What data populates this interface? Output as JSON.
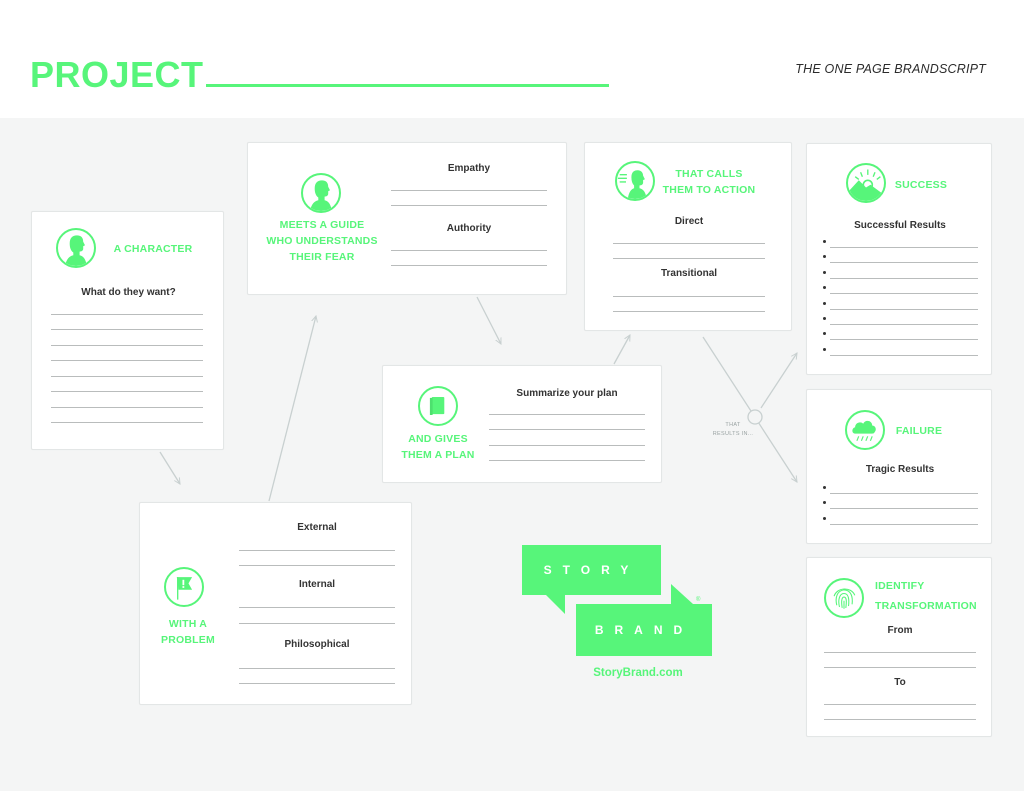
{
  "header": {
    "project_label": "PROJECT",
    "document_title": "THE ONE PAGE BRANDSCRIPT"
  },
  "brand_color": "#57f57a",
  "cards": {
    "character": {
      "icon": "person-silhouette-icon",
      "title": "A CHARACTER",
      "prompt": "What do they want?",
      "lines": 8
    },
    "guide": {
      "icon": "guide-silhouette-icon",
      "title_lines": [
        "MEETS A GUIDE",
        "WHO UNDERSTANDS",
        "THEIR FEAR"
      ],
      "fields": [
        "Empathy",
        "Authority"
      ]
    },
    "problem": {
      "icon": "flag-exclamation-icon",
      "title_lines": [
        "WITH A",
        "PROBLEM"
      ],
      "fields": [
        "External",
        "Internal",
        "Philosophical"
      ]
    },
    "plan": {
      "icon": "book-icon",
      "title_lines": [
        "AND GIVES",
        "THEM A PLAN"
      ],
      "prompt": "Summarize your plan"
    },
    "action": {
      "icon": "running-person-icon",
      "title_lines": [
        "THAT CALLS",
        "THEM TO ACTION"
      ],
      "fields": [
        "Direct",
        "Transitional"
      ]
    },
    "success": {
      "icon": "sun-mountain-icon",
      "title": "SUCCESS",
      "prompt": "Successful Results",
      "bullets": 8
    },
    "failure": {
      "icon": "rain-cloud-icon",
      "title": "FAILURE",
      "prompt": "Tragic Results",
      "bullets": 3
    },
    "transformation": {
      "icon": "fingerprint-icon",
      "title_lines": [
        "IDENTIFY",
        "TRANSFORMATION"
      ],
      "fields": [
        "From",
        "To"
      ]
    }
  },
  "connector": {
    "label_lines": [
      "THAT",
      "RESULTS IN..."
    ]
  },
  "logo": {
    "top_word": "STORY",
    "bottom_word": "BRAND",
    "registered": "®",
    "url": "StoryBrand.com"
  }
}
